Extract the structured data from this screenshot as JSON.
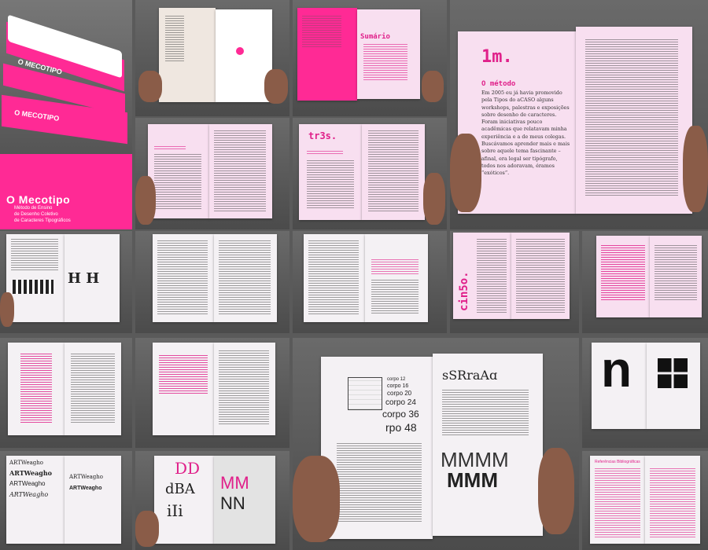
{
  "cover": {
    "title": "O Mecotipo",
    "subtitle_line1": "Método de Ensino",
    "subtitle_line2": "de Desenho Coletivo",
    "subtitle_line3": "de Caracteres Tipográficos",
    "brand_color": "#ff2a95",
    "spine_labels": [
      "O MECOTIPO",
      "O MECOTIPO",
      "O MECOTIPO"
    ]
  },
  "spreads": {
    "sumario": "Sumário",
    "method_number": "1m.",
    "method_title": "O método",
    "method_body": "Em 2005 eu já havia promovido pela Tipos do aCASO alguns workshops, palestras e exposições sobre desenho de caracteres. Foram iniciativas pouco acadêmicas que relatavam minha experiência e a de meus colegas. Buscávamos aprender mais e mais sobre aquele tema fascinante – afinal, era legal ser tipógrafo, todos nos adoravam, éramos “exóticos”.",
    "tres": "tr3s.",
    "cinco": "cin5o.",
    "sizes": [
      "corpo 12",
      "corpo 16",
      "corpo 20",
      "corpo 24",
      "corpo 36",
      "rpo 48"
    ],
    "sample_word": "sSRraAɑ",
    "m_row1": "MMMM",
    "m_row2": "MMM",
    "letter_n": "n",
    "art_word": "ARTWeagho",
    "dd": "DD",
    "aba": "dBA",
    "ili": "iIi",
    "mm": "MM",
    "nn": "NN",
    "hh": "H H",
    "referencias": "Referências Bibliográficas"
  }
}
